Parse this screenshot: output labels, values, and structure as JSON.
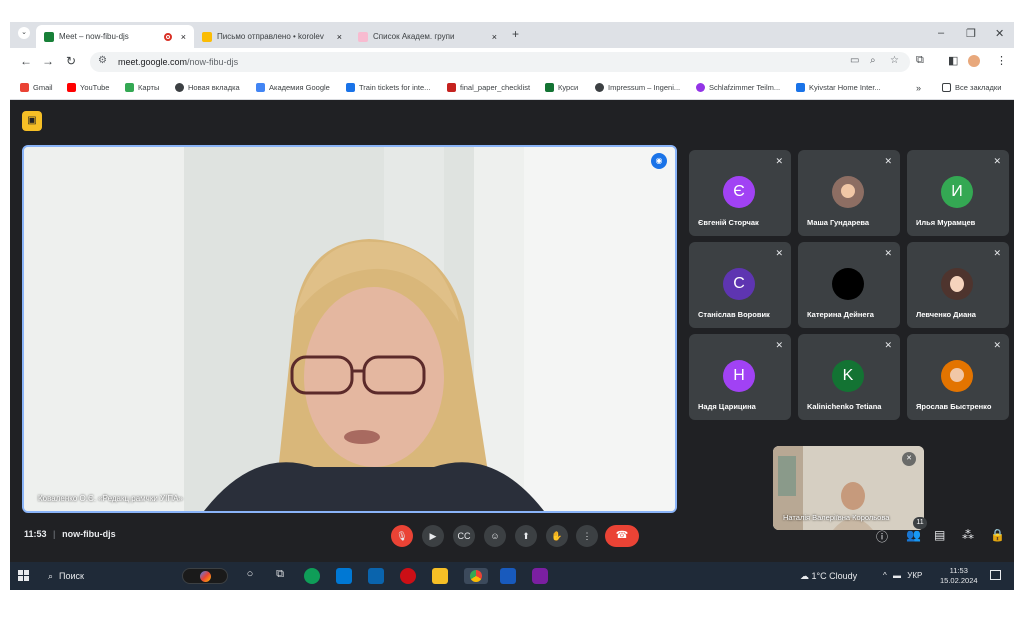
{
  "browser": {
    "tabs": [
      {
        "label": "Meet – now-fibu-djs",
        "close": "×",
        "fav_color": "#188038"
      },
      {
        "label": "Письмо отправлено • korolev",
        "close": "×",
        "fav_color": "#fbbc04"
      },
      {
        "label": "Список Академ. групи",
        "close": "×",
        "fav_color": "#f8bbd0"
      }
    ],
    "new_tab": "+",
    "url_host": "meet.google.com",
    "url_path": "/now-fibu-djs",
    "bookmarks": [
      {
        "label": "Gmail",
        "color": "#ea4335"
      },
      {
        "label": "YouTube",
        "color": "#ff0000"
      },
      {
        "label": "Карты",
        "color": "#34a853"
      },
      {
        "label": "Новая вкладка",
        "color": "#3c4043"
      },
      {
        "label": "Академия Google",
        "color": "#4285f4"
      },
      {
        "label": "Train tickets for inte...",
        "color": "#1a73e8"
      },
      {
        "label": "final_paper_checklist",
        "color": "#c5221f"
      },
      {
        "label": "Курси",
        "color": "#137333"
      },
      {
        "label": "Impressum – Ingeni...",
        "color": "#3c4043"
      },
      {
        "label": "Schlafzimmer Teilm...",
        "color": "#9334e6"
      },
      {
        "label": "Kyivstar Home Inter...",
        "color": "#1a73e8"
      }
    ],
    "more_bookmarks": "»",
    "all_bookmarks": "Все закладки"
  },
  "meet": {
    "main_speaker_name": "Коваленко О.Є. «Редакц рамчки УІПА»",
    "participants": [
      {
        "name": "Євгеній Сторчак",
        "initial": "Є",
        "color": "#a142f4",
        "photo": false
      },
      {
        "name": "Маша Гундарева",
        "initial": "",
        "color": "#5f6368",
        "photo": true
      },
      {
        "name": "Илья Мурамцев",
        "initial": "И",
        "color": "#34a853",
        "photo": false
      },
      {
        "name": "Станіслав Воровик",
        "initial": "С",
        "color": "#5e35b1",
        "photo": false
      },
      {
        "name": "Катерина Дейнега",
        "initial": "",
        "color": "#000000",
        "photo": false
      },
      {
        "name": "Левченко Диана",
        "initial": "",
        "color": "#5f6368",
        "photo": true
      },
      {
        "name": "Надя Царицина",
        "initial": "Н",
        "color": "#a142f4",
        "photo": false
      },
      {
        "name": "Kalinichenko Tetiana",
        "initial": "K",
        "color": "#137333",
        "photo": false
      },
      {
        "name": "Ярослав Быстренко",
        "initial": "",
        "color": "#5f6368",
        "photo": true
      }
    ],
    "self_name": "Наталія Валеріївна Корольова",
    "time": "11:53",
    "meeting_code": "now-fibu-djs",
    "participant_count": "11"
  },
  "taskbar": {
    "search_label": "Поиск",
    "weather": "1°C  Cloudy",
    "language": "УКР",
    "clock_time": "11:53",
    "clock_date": "15.02.2024"
  }
}
